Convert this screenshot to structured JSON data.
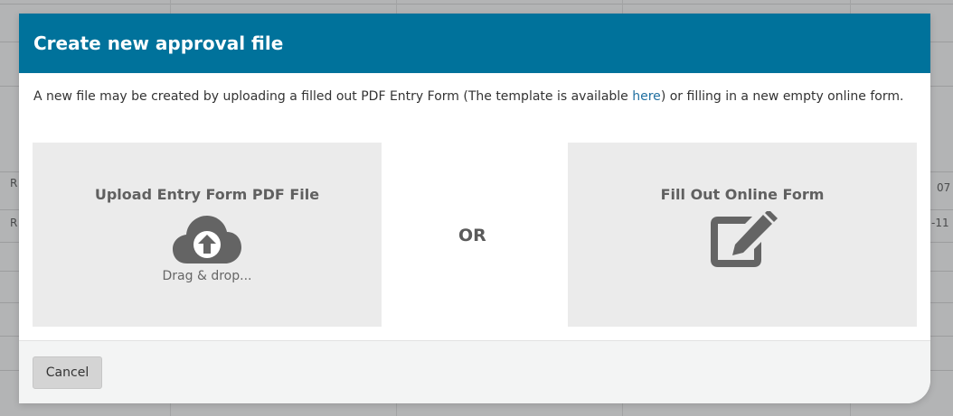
{
  "modal": {
    "title": "Create new approval file",
    "intro_before_link": "A new file may be created by uploading a filled out PDF Entry Form (The template is available ",
    "intro_link": "here",
    "intro_after_link": ") or filling in a new empty online form."
  },
  "upload_option": {
    "title": "Upload Entry Form PDF File",
    "icon": "cloud-upload-icon",
    "hint": "Drag & drop..."
  },
  "separator": "OR",
  "online_option": {
    "title": "Fill Out Online Form",
    "icon": "edit-icon"
  },
  "footer": {
    "cancel_label": "Cancel"
  },
  "background_fragments": {
    "right_a": "07",
    "right_b": "-11",
    "left_a": "R",
    "left_b": "R"
  },
  "colors": {
    "header": "#00729b",
    "option_bg": "#ebebeb",
    "link": "#1f6fa0"
  }
}
